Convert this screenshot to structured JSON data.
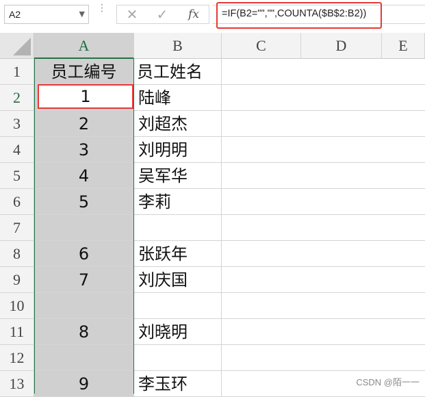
{
  "name_box": {
    "value": "A2"
  },
  "formula_bar": {
    "cancel_icon": "close-icon",
    "enter_icon": "check-icon",
    "fx_label": "fx",
    "formula": "=IF(B2=\"\",\"\",COUNTA($B$2:B2))"
  },
  "columns": [
    "A",
    "B",
    "C",
    "D",
    "E"
  ],
  "rows": [
    {
      "num": "1",
      "a": "员工编号",
      "b": "员工姓名"
    },
    {
      "num": "2",
      "a": "1",
      "b": "陆峰"
    },
    {
      "num": "3",
      "a": "2",
      "b": "刘超杰"
    },
    {
      "num": "4",
      "a": "3",
      "b": "刘明明"
    },
    {
      "num": "5",
      "a": "4",
      "b": "吴军华"
    },
    {
      "num": "6",
      "a": "5",
      "b": "李莉"
    },
    {
      "num": "7",
      "a": "",
      "b": ""
    },
    {
      "num": "8",
      "a": "6",
      "b": "张跃年"
    },
    {
      "num": "9",
      "a": "7",
      "b": "刘庆国"
    },
    {
      "num": "10",
      "a": "",
      "b": ""
    },
    {
      "num": "11",
      "a": "8",
      "b": "刘晓明"
    },
    {
      "num": "12",
      "a": "",
      "b": ""
    },
    {
      "num": "13",
      "a": "9",
      "b": "李玉环"
    }
  ],
  "watermark": "CSDN @陌一一",
  "colors": {
    "selection": "#217346",
    "highlight": "#e53935",
    "selected_fill": "#d0d0d0"
  }
}
